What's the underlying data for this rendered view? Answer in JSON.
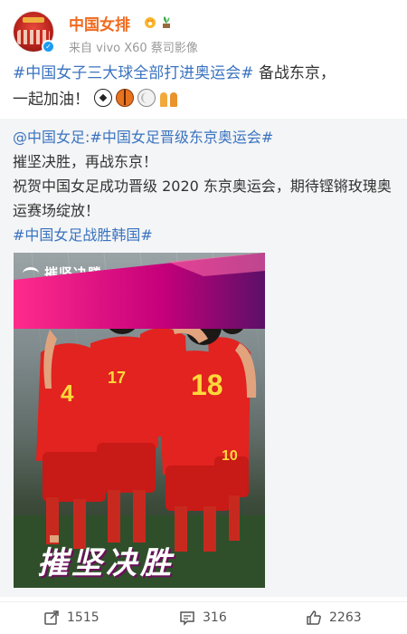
{
  "user": {
    "name": "中国女排",
    "source_prefix": "来自",
    "device": "vivo X60 蔡司影像"
  },
  "post": {
    "hashtag": "#中国女子三大球全部打进奥运会#",
    "text_main": " 备战东京，",
    "text_line2": "一起加油！"
  },
  "repost": {
    "mention": "@中国女足",
    "mention_sep": ":",
    "hashtag1": "#中国女足晋级东京奥运会#",
    "line1": "摧坚决胜，再战东京！",
    "line2": "祝贺中国女足成功晋级 2020 东京奥运会，期待铿锵玫瑰奥运赛场绽放！",
    "hashtag2": "#中国女足战胜韩国#",
    "image": {
      "logo_text": "摧坚决勝",
      "banner_text": "摧坚决胜",
      "jersey_numbers": [
        "4",
        "17",
        "18",
        "10"
      ]
    }
  },
  "actions": {
    "repost_count": "1515",
    "comment_count": "316",
    "like_count": "2263"
  },
  "colors": {
    "username": "#f06a1e",
    "hashtag": "#3a73c0",
    "jersey": "#e8231f",
    "banner": "#e3007f"
  },
  "icons": [
    "verified-icon",
    "crown-badge-icon",
    "plant-badge-icon",
    "soccer-ball-icon",
    "basketball-icon",
    "volleyball-icon",
    "team-icon",
    "repost-icon",
    "comment-icon",
    "like-icon"
  ]
}
